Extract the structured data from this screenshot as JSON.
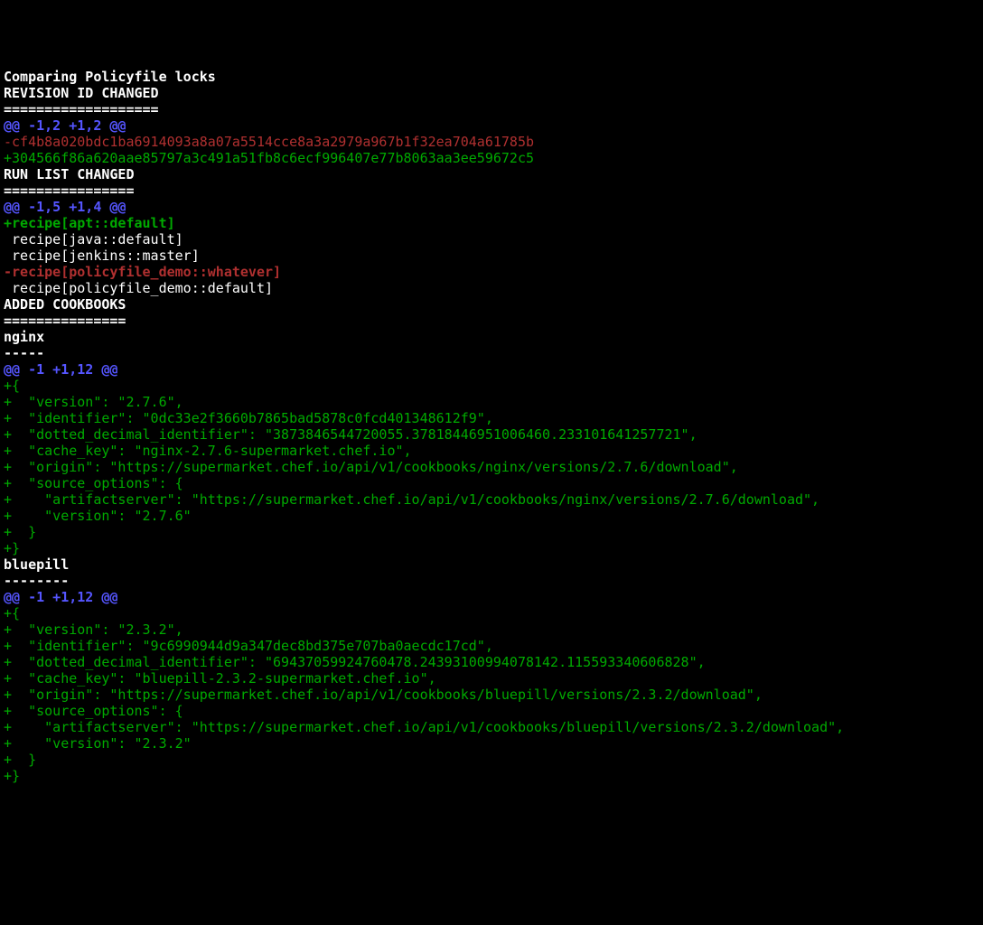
{
  "header": {
    "title": "Comparing Policyfile locks"
  },
  "sections": [
    {
      "heading": "REVISION ID CHANGED",
      "underline": "===================",
      "hunk": "@@ -1,2 +1,2 @@",
      "lines": [
        {
          "type": "del",
          "text": "-cf4b8a020bdc1ba6914093a8a07a5514cce8a3a2979a967b1f32ea704a61785b"
        },
        {
          "type": "add",
          "text": "+304566f86a620aae85797a3c491a51fb8c6ecf996407e77b8063aa3ee59672c5"
        }
      ]
    },
    {
      "heading": "RUN LIST CHANGED",
      "underline": "================",
      "hunk": "@@ -1,5 +1,4 @@",
      "lines": [
        {
          "type": "addb",
          "text": "+recipe[apt::default]"
        },
        {
          "type": "ctx",
          "text": " recipe[java::default]"
        },
        {
          "type": "ctx",
          "text": " recipe[jenkins::master]"
        },
        {
          "type": "delb",
          "text": "-recipe[policyfile_demo::whatever]"
        },
        {
          "type": "ctx",
          "text": " recipe[policyfile_demo::default]"
        }
      ]
    }
  ],
  "added_cookbooks": {
    "heading": "ADDED COOKBOOKS",
    "underline": "===============",
    "entries": [
      {
        "name": "nginx",
        "rule": "-----",
        "hunk": "@@ -1 +1,12 @@",
        "lines": [
          {
            "type": "add",
            "text": "+{"
          },
          {
            "type": "add",
            "text": "+  \"version\": \"2.7.6\","
          },
          {
            "type": "add",
            "text": "+  \"identifier\": \"0dc33e2f3660b7865bad5878c0fcd401348612f9\","
          },
          {
            "type": "add",
            "text": "+  \"dotted_decimal_identifier\": \"3873846544720055.37818446951006460.233101641257721\","
          },
          {
            "type": "add",
            "text": "+  \"cache_key\": \"nginx-2.7.6-supermarket.chef.io\","
          },
          {
            "type": "add",
            "text": "+  \"origin\": \"https://supermarket.chef.io/api/v1/cookbooks/nginx/versions/2.7.6/download\","
          },
          {
            "type": "add",
            "text": "+  \"source_options\": {"
          },
          {
            "type": "add",
            "text": "+    \"artifactserver\": \"https://supermarket.chef.io/api/v1/cookbooks/nginx/versions/2.7.6/download\","
          },
          {
            "type": "add",
            "text": "+    \"version\": \"2.7.6\""
          },
          {
            "type": "add",
            "text": "+  }"
          },
          {
            "type": "add",
            "text": "+}"
          }
        ]
      },
      {
        "name": "bluepill",
        "rule": "--------",
        "hunk": "@@ -1 +1,12 @@",
        "lines": [
          {
            "type": "add",
            "text": "+{"
          },
          {
            "type": "add",
            "text": "+  \"version\": \"2.3.2\","
          },
          {
            "type": "add",
            "text": "+  \"identifier\": \"9c6990944d9a347dec8bd375e707ba0aecdc17cd\","
          },
          {
            "type": "add",
            "text": "+  \"dotted_decimal_identifier\": \"69437059924760478.24393100994078142.115593340606828\","
          },
          {
            "type": "add",
            "text": "+  \"cache_key\": \"bluepill-2.3.2-supermarket.chef.io\","
          },
          {
            "type": "add",
            "text": "+  \"origin\": \"https://supermarket.chef.io/api/v1/cookbooks/bluepill/versions/2.3.2/download\","
          },
          {
            "type": "add",
            "text": "+  \"source_options\": {"
          },
          {
            "type": "add",
            "text": "+    \"artifactserver\": \"https://supermarket.chef.io/api/v1/cookbooks/bluepill/versions/2.3.2/download\","
          },
          {
            "type": "add",
            "text": "+    \"version\": \"2.3.2\""
          },
          {
            "type": "add",
            "text": "+  }"
          },
          {
            "type": "add",
            "text": "+}"
          }
        ]
      }
    ]
  }
}
